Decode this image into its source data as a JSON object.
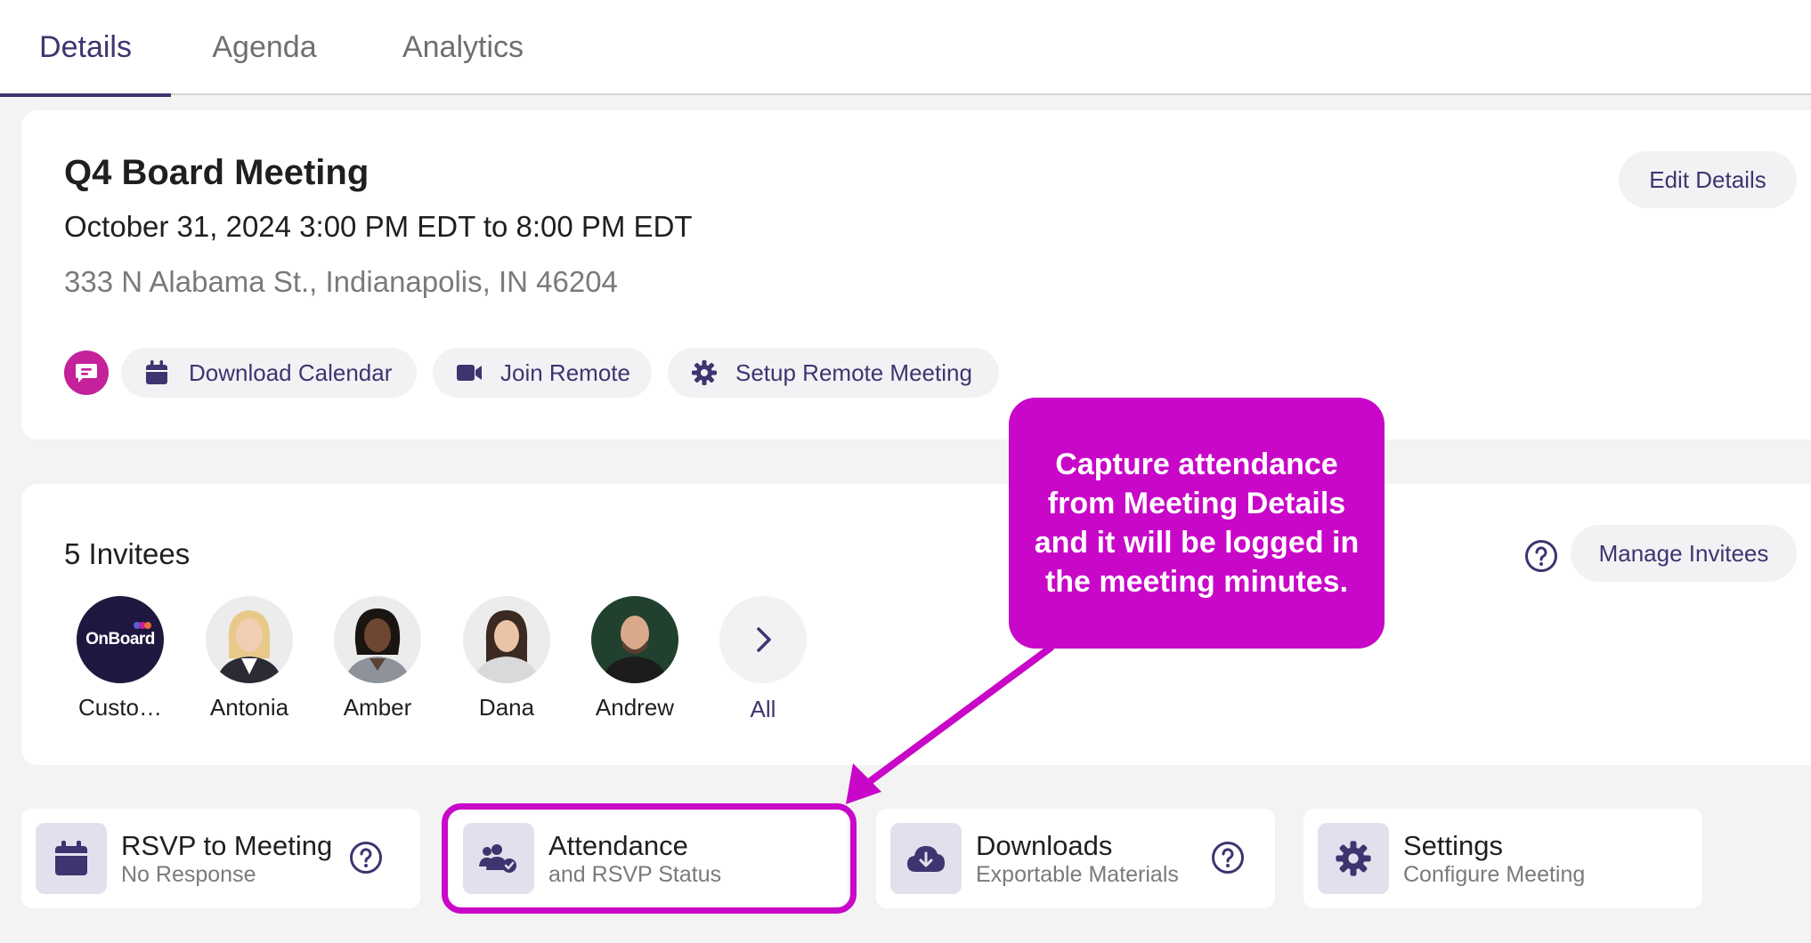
{
  "tabs": [
    {
      "label": "Details",
      "active": true
    },
    {
      "label": "Agenda",
      "active": false
    },
    {
      "label": "Analytics",
      "active": false
    }
  ],
  "meeting": {
    "title": "Q4 Board Meeting",
    "datetime": "October 31, 2024 3:00 PM EDT to 8:00 PM EDT",
    "address": "333 N Alabama St., Indianapolis, IN 46204",
    "edit_label": "Edit Details",
    "actions": {
      "download_calendar": "Download Calendar",
      "join_remote": "Join Remote",
      "setup_remote": "Setup Remote Meeting"
    }
  },
  "invitees": {
    "count_label": "5 Invitees",
    "manage_label": "Manage Invitees",
    "people": [
      {
        "name": "Custo…",
        "logo_text": "OnBoard"
      },
      {
        "name": "Antonia"
      },
      {
        "name": "Amber"
      },
      {
        "name": "Dana"
      },
      {
        "name": "Andrew"
      }
    ],
    "all_label": "All"
  },
  "tiles": {
    "rsvp": {
      "title": "RSVP to Meeting",
      "subtitle": "No Response"
    },
    "attendance": {
      "title": "Attendance",
      "subtitle": "and RSVP Status"
    },
    "downloads": {
      "title": "Downloads",
      "subtitle": "Exportable Materials"
    },
    "settings": {
      "title": "Settings",
      "subtitle": "Configure Meeting"
    }
  },
  "callout": {
    "text": "Capture attendance from Meeting Details and it will be logged in the meeting minutes."
  },
  "colors": {
    "accent": "#3e3470",
    "annotation": "#c807c8",
    "chat_bubble": "#c4219a",
    "icon_bg": "#e3e0ee"
  }
}
